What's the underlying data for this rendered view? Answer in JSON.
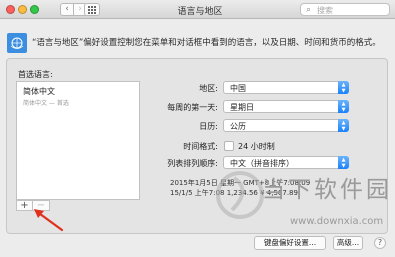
{
  "window": {
    "title": "语言与地区",
    "search_placeholder": "搜索"
  },
  "header": {
    "description": "“语言与地区”偏好设置控制您在菜单和对话框中看到的语言，以及日期、时间和货币的格式。"
  },
  "languages": {
    "label": "首选语言:",
    "items": [
      {
        "name": "简体中文",
        "subtitle": "简体中文 — 首选"
      }
    ]
  },
  "settings": {
    "region_label": "地区:",
    "region_value": "中国",
    "first_day_label": "每周的第一天:",
    "first_day_value": "星期日",
    "calendar_label": "日历:",
    "calendar_value": "公历",
    "time_format_label": "时间格式:",
    "time_format_option": "24 小时制",
    "list_sort_label": "列表排列顺序:",
    "list_sort_value": "中文（拼音排序）"
  },
  "sample": {
    "line1": "2015年1月5日 星期一 GMT+8上午7:08:09",
    "line2": "15/1/5 上午7:08     1,234.56     ¥ 4,567.89"
  },
  "buttons": {
    "add": "+",
    "remove": "−",
    "keyboard": "键盘偏好设置...",
    "advanced": "高级...",
    "help": "?"
  },
  "watermark": {
    "text": "当下软件园",
    "url": "www.downxia.com"
  },
  "colors": {
    "accent": "#1a82fb",
    "arrow": "#e0301e"
  }
}
